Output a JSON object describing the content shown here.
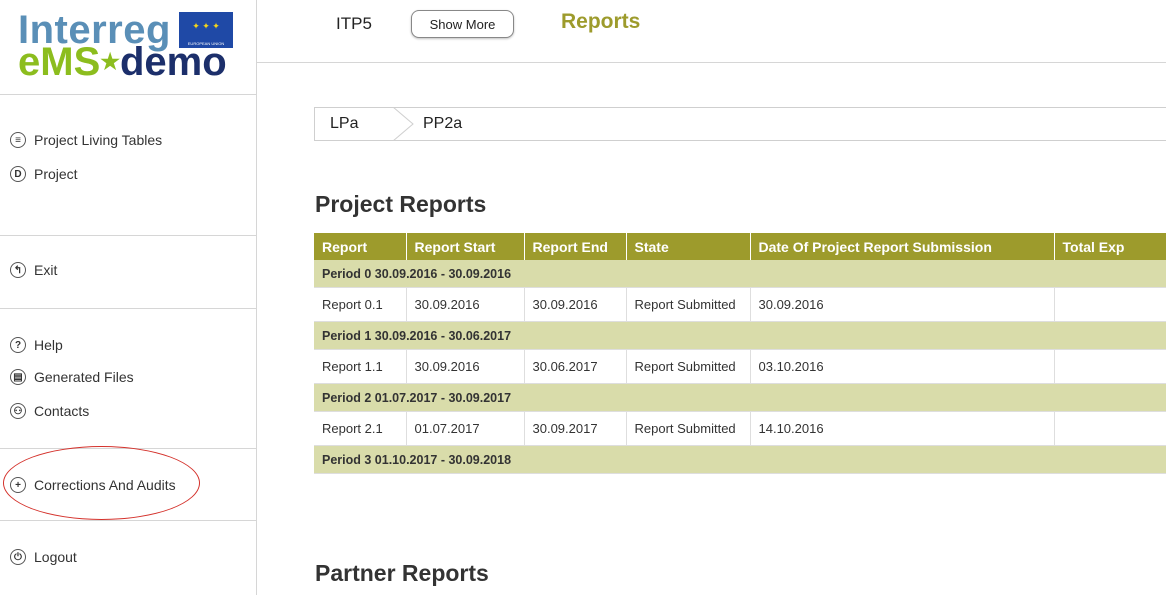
{
  "logo": {
    "line1": "Interreg",
    "eu_text": "EUROPEAN UNION",
    "ems": "eMS",
    "demo": "demo"
  },
  "sidebar": {
    "items": [
      {
        "label": "Project Living Tables",
        "icon": "table-icon"
      },
      {
        "label": "Project",
        "icon": "project-icon"
      },
      {
        "label": "Exit",
        "icon": "back-icon"
      },
      {
        "label": "Help",
        "icon": "help-icon"
      },
      {
        "label": "Generated Files",
        "icon": "files-icon"
      },
      {
        "label": "Contacts",
        "icon": "contacts-icon"
      },
      {
        "label": "Corrections And Audits",
        "icon": "plus-icon"
      },
      {
        "label": "Logout",
        "icon": "power-icon"
      }
    ]
  },
  "header": {
    "project_code": "ITP5",
    "show_more": "Show More",
    "title": "Reports"
  },
  "breadcrumb": [
    "LPa",
    "PP2a"
  ],
  "project_reports": {
    "title": "Project Reports",
    "columns": [
      "Report",
      "Report Start",
      "Report End",
      "State",
      "Date Of Project Report Submission",
      "Total Exp"
    ],
    "periods": [
      {
        "label": "Period 0 30.09.2016 - 30.09.2016",
        "row": {
          "report": "Report 0.1",
          "start": "30.09.2016",
          "end": "30.09.2016",
          "state": "Report Submitted",
          "submission": "30.09.2016",
          "total": ""
        }
      },
      {
        "label": "Period 1 30.09.2016 - 30.06.2017",
        "row": {
          "report": "Report 1.1",
          "start": "30.09.2016",
          "end": "30.06.2017",
          "state": "Report Submitted",
          "submission": "03.10.2016",
          "total": ""
        }
      },
      {
        "label": "Period 2 01.07.2017 - 30.09.2017",
        "row": {
          "report": "Report 2.1",
          "start": "01.07.2017",
          "end": "30.09.2017",
          "state": "Report Submitted",
          "submission": "14.10.2016",
          "total": ""
        }
      },
      {
        "label": "Period 3 01.10.2017 - 30.09.2018"
      }
    ]
  },
  "partner_reports": {
    "title": "Partner Reports"
  },
  "colors": {
    "accent": "#9d9b2c",
    "period_bg": "#d9dcaa",
    "highlight": "#d4312b"
  }
}
